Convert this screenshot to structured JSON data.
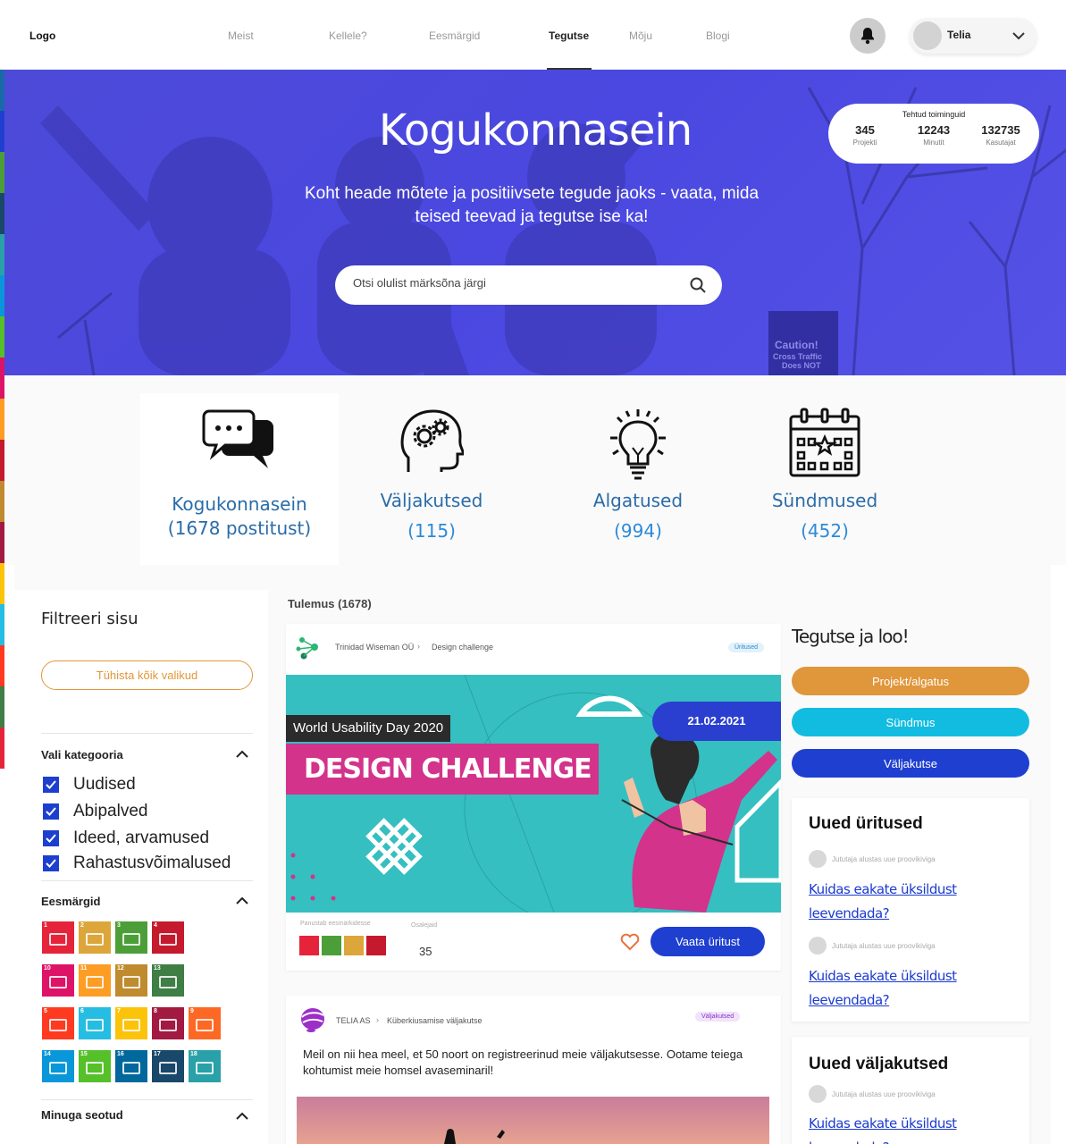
{
  "header": {
    "logo": "Logo",
    "nav": [
      "Meist",
      "Kellele?",
      "Eesmärgid",
      "Tegutse",
      "Mõju",
      "Blogi"
    ],
    "active_nav": "Tegutse",
    "user_name": "Telia"
  },
  "hero": {
    "title": "Kogukonnasein",
    "subtitle": "Koht heade mõtete ja positiivsete tegude jaoks - vaata, mida teised teevad ja tegutse ise ka!",
    "search_placeholder": "Otsi olulist märksõna järgi",
    "stats": {
      "title": "Tehtud toiminguid",
      "items": [
        {
          "value": "345",
          "label": "Projekti"
        },
        {
          "value": "12243",
          "label": "Minutit"
        },
        {
          "value": "132735",
          "label": "Kasutajat"
        }
      ]
    },
    "sign_text": [
      "Caution!",
      "Cross Traffic",
      "Does NOT"
    ]
  },
  "categories": [
    {
      "name": "Kogukonnasein",
      "count": "(1678 postitust)",
      "icon": "chat-bubbles-icon"
    },
    {
      "name": "Väljakutsed",
      "count": "(115)",
      "icon": "head-gears-icon"
    },
    {
      "name": "Algatused",
      "count": "(994)",
      "icon": "lightbulb-icon"
    },
    {
      "name": "Sündmused",
      "count": "(452)",
      "icon": "calendar-icon"
    }
  ],
  "filter": {
    "title": "Filtreeri sisu",
    "clear_label": "Tühista kõik valikud",
    "category_section": "Vali kategooria",
    "categories": [
      "Uudised",
      "Abipalved",
      "Ideed, arvamused",
      "Rahastusvõimalused"
    ],
    "goals_section": "Eesmärgid",
    "goals": [
      {
        "n": "1",
        "color": "#e5243b"
      },
      {
        "n": "2",
        "color": "#dda63a"
      },
      {
        "n": "3",
        "color": "#4c9f38"
      },
      {
        "n": "4",
        "color": "#c5192d"
      },
      {
        "n": "10",
        "color": "#dd1367"
      },
      {
        "n": "11",
        "color": "#fd9d24"
      },
      {
        "n": "12",
        "color": "#bf8b2e"
      },
      {
        "n": "13",
        "color": "#3f7e44"
      },
      {
        "n": "5",
        "color": "#ff3a21"
      },
      {
        "n": "6",
        "color": "#26bde2"
      },
      {
        "n": "7",
        "color": "#fcc30b"
      },
      {
        "n": "8",
        "color": "#a21942"
      },
      {
        "n": "9",
        "color": "#fd6925"
      },
      {
        "n": "14",
        "color": "#0a97d9"
      },
      {
        "n": "15",
        "color": "#56c02b"
      },
      {
        "n": "16",
        "color": "#00689d"
      },
      {
        "n": "17",
        "color": "#19486a"
      },
      {
        "n": "18",
        "color": "#2aa1a8"
      }
    ],
    "mine_section": "Minuga seotud"
  },
  "results": {
    "label": "Tulemus (1678)",
    "card1": {
      "org": "Trinidad Wiseman OÜ",
      "sub": "Design challenge",
      "tag": "Üritused",
      "banner_top": "World Usability Day 2020",
      "banner_title": "DESIGN CHALLENGE",
      "banner_date": "21.02.2021",
      "goals_label": "Panustab eesmärkidesse",
      "participants_label": "Osalejaid",
      "participants": "35",
      "cta": "Vaata üritust"
    },
    "card2": {
      "org": "TELIA AS",
      "sub": "Küberkiusamise väljakutse",
      "tag": "Väljakutsed",
      "text": "Meil on nii hea meel, et 50 noort on registreerinud meie väljakutsesse. Ootame teiega kohtumist meie homsel avaseminaril!"
    }
  },
  "right": {
    "title": "Tegutse ja loo!",
    "buttons": [
      {
        "label": "Projekt/algatus",
        "color": "#e0963a"
      },
      {
        "label": "Sündmus",
        "color": "#12bce0"
      },
      {
        "label": "Väljakutse",
        "color": "#1f3fd0"
      }
    ],
    "events": {
      "title": "Uued üritused",
      "items": [
        {
          "author": "Jututaja alustas uue proovikiviga",
          "link": "Kuidas eakate üksildust leevendada?"
        },
        {
          "author": "Jututaja alustas uue proovikiviga",
          "link": "Kuidas eakate üksildust leevendada?"
        }
      ]
    },
    "challenges": {
      "title": "Uued väljakutsed",
      "items": [
        {
          "author": "Jututaja alustas uue proovikiviga",
          "link": "Kuidas eakate üksildust leevendada?"
        }
      ]
    }
  },
  "colors": {
    "stripe": [
      "#1a6aa8",
      "#1f3fd0",
      "#4c9f38",
      "#19486a",
      "#2aa1a8",
      "#0a97d9",
      "#56c02b",
      "#dd1367",
      "#fd9d24",
      "#c5192d",
      "#bf8b2e",
      "#a21942",
      "#fcc30b",
      "#26bde2",
      "#ff3a21",
      "#3f7e44",
      "#e5243b"
    ]
  }
}
